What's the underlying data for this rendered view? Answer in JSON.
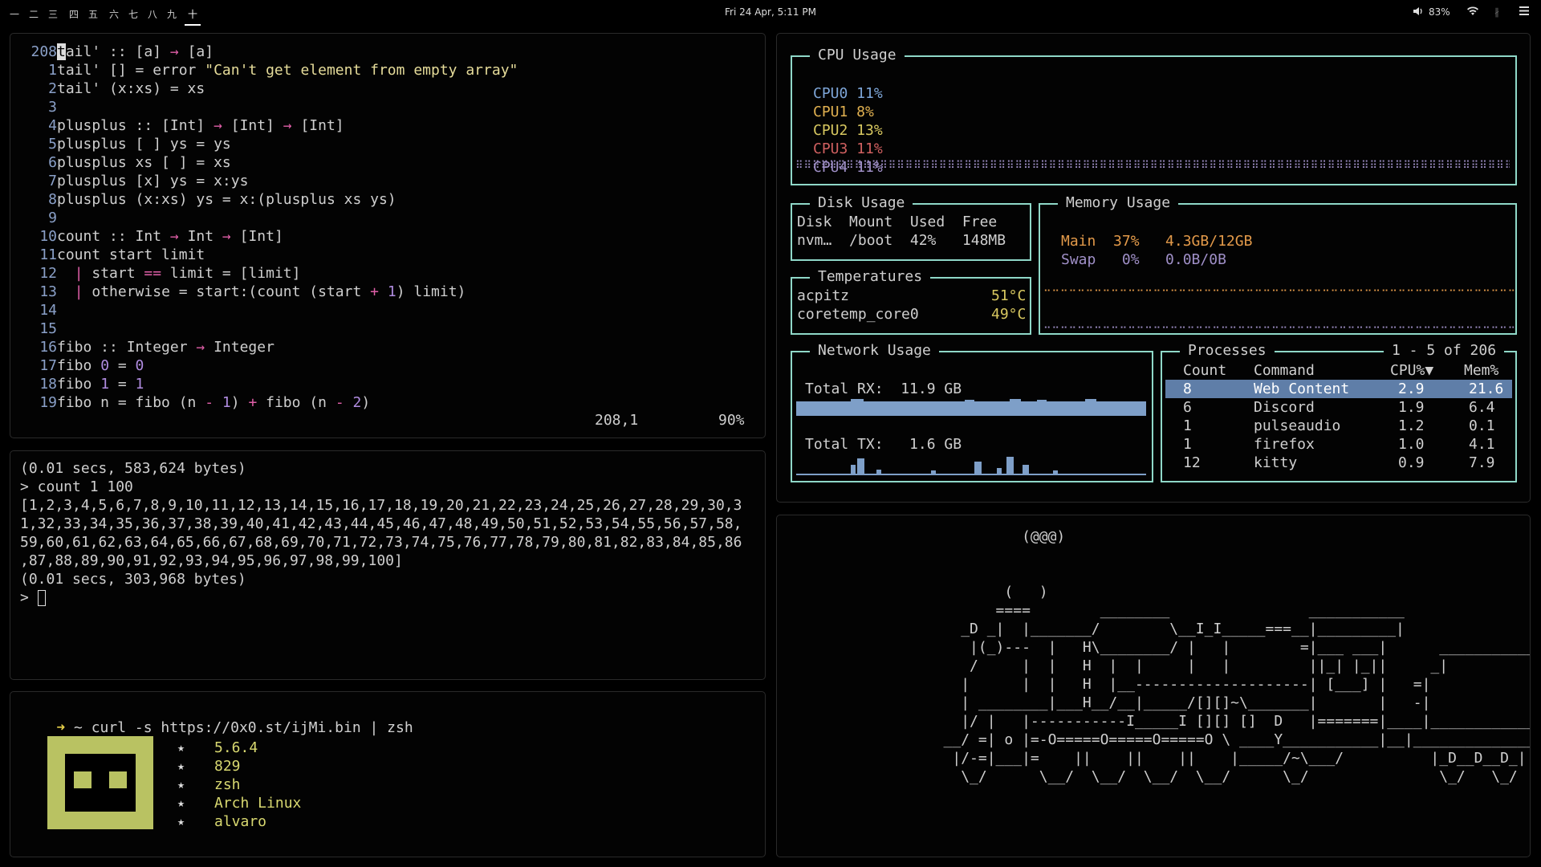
{
  "topbar": {
    "workspaces": [
      "一",
      "二",
      "三",
      "四",
      "五",
      "六",
      "七",
      "八",
      "九",
      "十"
    ],
    "active_workspace": 9,
    "clock": "Fri 24 Apr,  5:11 PM",
    "volume": "83%"
  },
  "editor": {
    "lines": [
      {
        "n": "208",
        "html": "<span style='background:#ddd;color:#000'>t</span>ail' :: [a] <span class='kw'>→</span> [a]"
      },
      {
        "n": "1",
        "html": "tail' [] = error <span class='str'>\"Can't get element from empty array\"</span>"
      },
      {
        "n": "2",
        "html": "tail' (x:xs) = xs"
      },
      {
        "n": "3",
        "html": ""
      },
      {
        "n": "4",
        "html": "plusplus :: [Int] <span class='kw'>→</span> [Int] <span class='kw'>→</span> [Int]"
      },
      {
        "n": "5",
        "html": "plusplus [ ] ys = ys"
      },
      {
        "n": "6",
        "html": "plusplus xs [ ] = xs"
      },
      {
        "n": "7",
        "html": "plusplus [x] ys = x:ys"
      },
      {
        "n": "8",
        "html": "plusplus (x:xs) ys = x:(plusplus xs ys)"
      },
      {
        "n": "9",
        "html": ""
      },
      {
        "n": "10",
        "html": "count :: Int <span class='kw'>→</span> Int <span class='kw'>→</span> [Int]"
      },
      {
        "n": "11",
        "html": "count start limit"
      },
      {
        "n": "12",
        "html": "  <span class='kw'>|</span> start <span class='kw'>==</span> limit = [limit]"
      },
      {
        "n": "13",
        "html": "  <span class='kw'>|</span> otherwise = start:(count (start <span class='kw'>+</span> <span class='num'>1</span>) limit)"
      },
      {
        "n": "14",
        "html": ""
      },
      {
        "n": "15",
        "html": ""
      },
      {
        "n": "16",
        "html": "fibo :: Integer <span class='kw'>→</span> Integer"
      },
      {
        "n": "17",
        "html": "fibo <span class='num'>0</span> = <span class='num'>0</span>"
      },
      {
        "n": "18",
        "html": "fibo <span class='num'>1</span> = <span class='num'>1</span>"
      },
      {
        "n": "19",
        "html": "fibo n = fibo (n <span class='kw'>-</span> <span class='num'>1</span>) <span class='kw'>+</span> fibo (n <span class='kw'>-</span> <span class='num'>2</span>)"
      }
    ],
    "cursor_pos": "208,1",
    "scroll_pct": "90%"
  },
  "repl": {
    "lines": [
      "(0.01 secs, 583,624 bytes)",
      "> count 1 100",
      "[1,2,3,4,5,6,7,8,9,10,11,12,13,14,15,16,17,18,19,20,21,22,23,24,25,26,27,28,29,30,3",
      "1,32,33,34,35,36,37,38,39,40,41,42,43,44,45,46,47,48,49,50,51,52,53,54,55,56,57,58,",
      "59,60,61,62,63,64,65,66,67,68,69,70,71,72,73,74,75,76,77,78,79,80,81,82,83,84,85,86",
      ",87,88,89,90,91,92,93,94,95,96,97,98,99,100]",
      "(0.01 secs, 303,968 bytes)",
      "> "
    ]
  },
  "shell": {
    "arrow": "➜",
    "prompt": " ~ curl -s https://0x0.st/ijMi.bin | zsh",
    "info": [
      "5.6.4",
      "829",
      "zsh",
      "Arch Linux",
      "alvaro"
    ],
    "bullet": "★"
  },
  "monitor": {
    "cpu_title": "CPU Usage",
    "cpus": [
      {
        "label": "CPU0 11%",
        "color": "#7ea6d8"
      },
      {
        "label": "CPU1 8%",
        "color": "#e0b050"
      },
      {
        "label": "CPU2 13%",
        "color": "#d8c860"
      },
      {
        "label": "CPU3 11%",
        "color": "#d06060"
      },
      {
        "label": "CPU4 11%",
        "color": "#a090c8"
      }
    ],
    "disk_title": "Disk Usage",
    "disk_header": "Disk  Mount  Used  Free",
    "disk_row": "nvm…  /boot  42%   148MB",
    "temp_title": "Temperatures",
    "temps": [
      {
        "name": "acpitz",
        "value": "51°C"
      },
      {
        "name": "coretemp_core0",
        "value": "49°C"
      }
    ],
    "mem_title": "Memory Usage",
    "mem_main": "Main  37%   4.3GB/12GB",
    "mem_swap": "Swap   0%   0.0B/0B",
    "net_title": "Network Usage",
    "net_rx": "Total RX:  11.9 GB",
    "net_tx": "Total TX:   1.6 GB",
    "proc_title": "Processes",
    "proc_count": "1 - 5 of 206",
    "proc_headers": [
      "Count",
      "Command",
      "CPU%▼",
      "Mem%"
    ],
    "procs": [
      [
        "8",
        "Web Content",
        "2.9",
        "21.6"
      ],
      [
        "6",
        "Discord",
        "1.9",
        "6.4"
      ],
      [
        "1",
        "pulseaudio",
        "1.2",
        "0.1"
      ],
      [
        "1",
        "firefox",
        "1.0",
        "4.1"
      ],
      [
        "12",
        "kitty",
        "0.9",
        "7.9"
      ]
    ]
  },
  "sl": {
    "art": "                  (@@@)\n\n\n                (   )\n               ====        ________                ___________\n           _D _|  |_______/        \\__I_I_____===__|_________|\n            |(_)---  |   H\\________/ |   |        =|___ ___|      _________________\n            /     |  |   H  |  |     |   |         ||_| |_||     _|\n           |      |  |   H  |__--------------------| [___] |   =|\n           | ________|___H__/__|_____/[][]~\\_______|       |   -|\n           |/ |   |-----------I_____I [][] []  D   |=======|____|__________________\n         __/ =| o |=-O=====O=====O=====O \\ ____Y___________|__|____________________\n          |/-=|___|=    ||    ||    ||    |_____/~\\___/          |_D__D__D_|  |_D__\n           \\_/      \\__/  \\__/  \\__/  \\__/      \\_/               \\_/   \\_/    \\_/"
  }
}
